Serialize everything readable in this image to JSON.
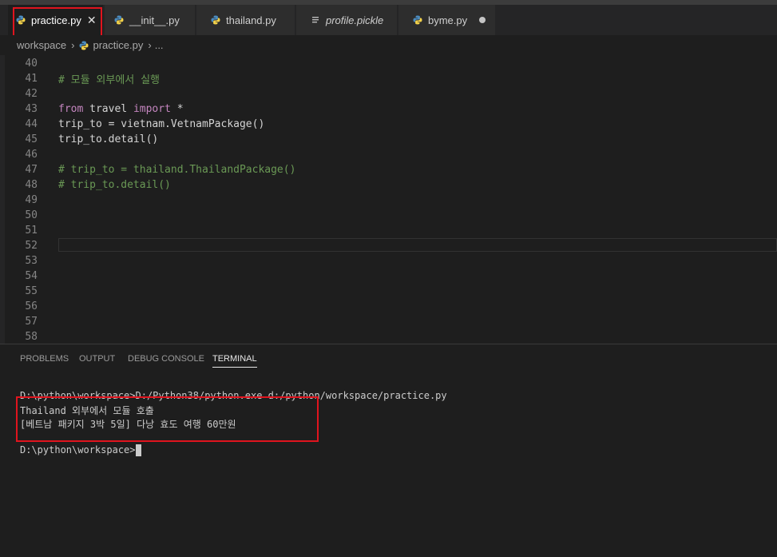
{
  "tabs": [
    {
      "label": "practice.py",
      "active": true,
      "icon": "python-icon"
    },
    {
      "label": "__init__.py",
      "icon": "python-icon"
    },
    {
      "label": "thailand.py",
      "icon": "python-icon"
    },
    {
      "label": "profile.pickle",
      "icon": "file-lines-icon"
    },
    {
      "label": "byme.py",
      "icon": "python-icon",
      "unsaved": true
    }
  ],
  "breadcrumb": {
    "folder": "workspace",
    "file": "practice.py",
    "more": "..."
  },
  "editor": {
    "lines": [
      {
        "n": "40",
        "text": ""
      },
      {
        "n": "41",
        "text": "# 모듈 외부에서 실행"
      },
      {
        "n": "42",
        "text": ""
      },
      {
        "n": "43",
        "kw1": "from",
        "mid": " travel ",
        "kw2": "import",
        "rest": " *"
      },
      {
        "n": "44",
        "text": "trip_to = vietnam.VetnamPackage()"
      },
      {
        "n": "45",
        "text": "trip_to.detail()"
      },
      {
        "n": "46",
        "text": ""
      },
      {
        "n": "47",
        "text": "# trip_to = thailand.ThailandPackage()"
      },
      {
        "n": "48",
        "text": "# trip_to.detail()"
      },
      {
        "n": "49",
        "text": ""
      },
      {
        "n": "50",
        "text": ""
      },
      {
        "n": "51",
        "text": ""
      },
      {
        "n": "52",
        "text": ""
      },
      {
        "n": "53",
        "text": ""
      },
      {
        "n": "54",
        "text": ""
      },
      {
        "n": "55",
        "text": ""
      },
      {
        "n": "56",
        "text": ""
      },
      {
        "n": "57",
        "text": ""
      },
      {
        "n": "58",
        "text": ""
      }
    ]
  },
  "panel": {
    "tabs": [
      "PROBLEMS",
      "OUTPUT",
      "DEBUG CONSOLE",
      "TERMINAL"
    ],
    "active_tab": "TERMINAL",
    "terminal": {
      "command": "D:\\python\\workspace>D:/Python38/python.exe d:/python/workspace/practice.py",
      "output1": "Thailand 외부에서 모듈 호출",
      "output2": "[베트남 패키지 3박 5일] 다낭 효도 여행 60만원",
      "prompt": "D:\\python\\workspace>"
    }
  },
  "colors": {
    "accent_highlight": "#e0141e",
    "keyword": "#c586c0",
    "comment": "#6a9955",
    "python_blue": "#4b8bbe",
    "python_yellow": "#f2d14a"
  }
}
